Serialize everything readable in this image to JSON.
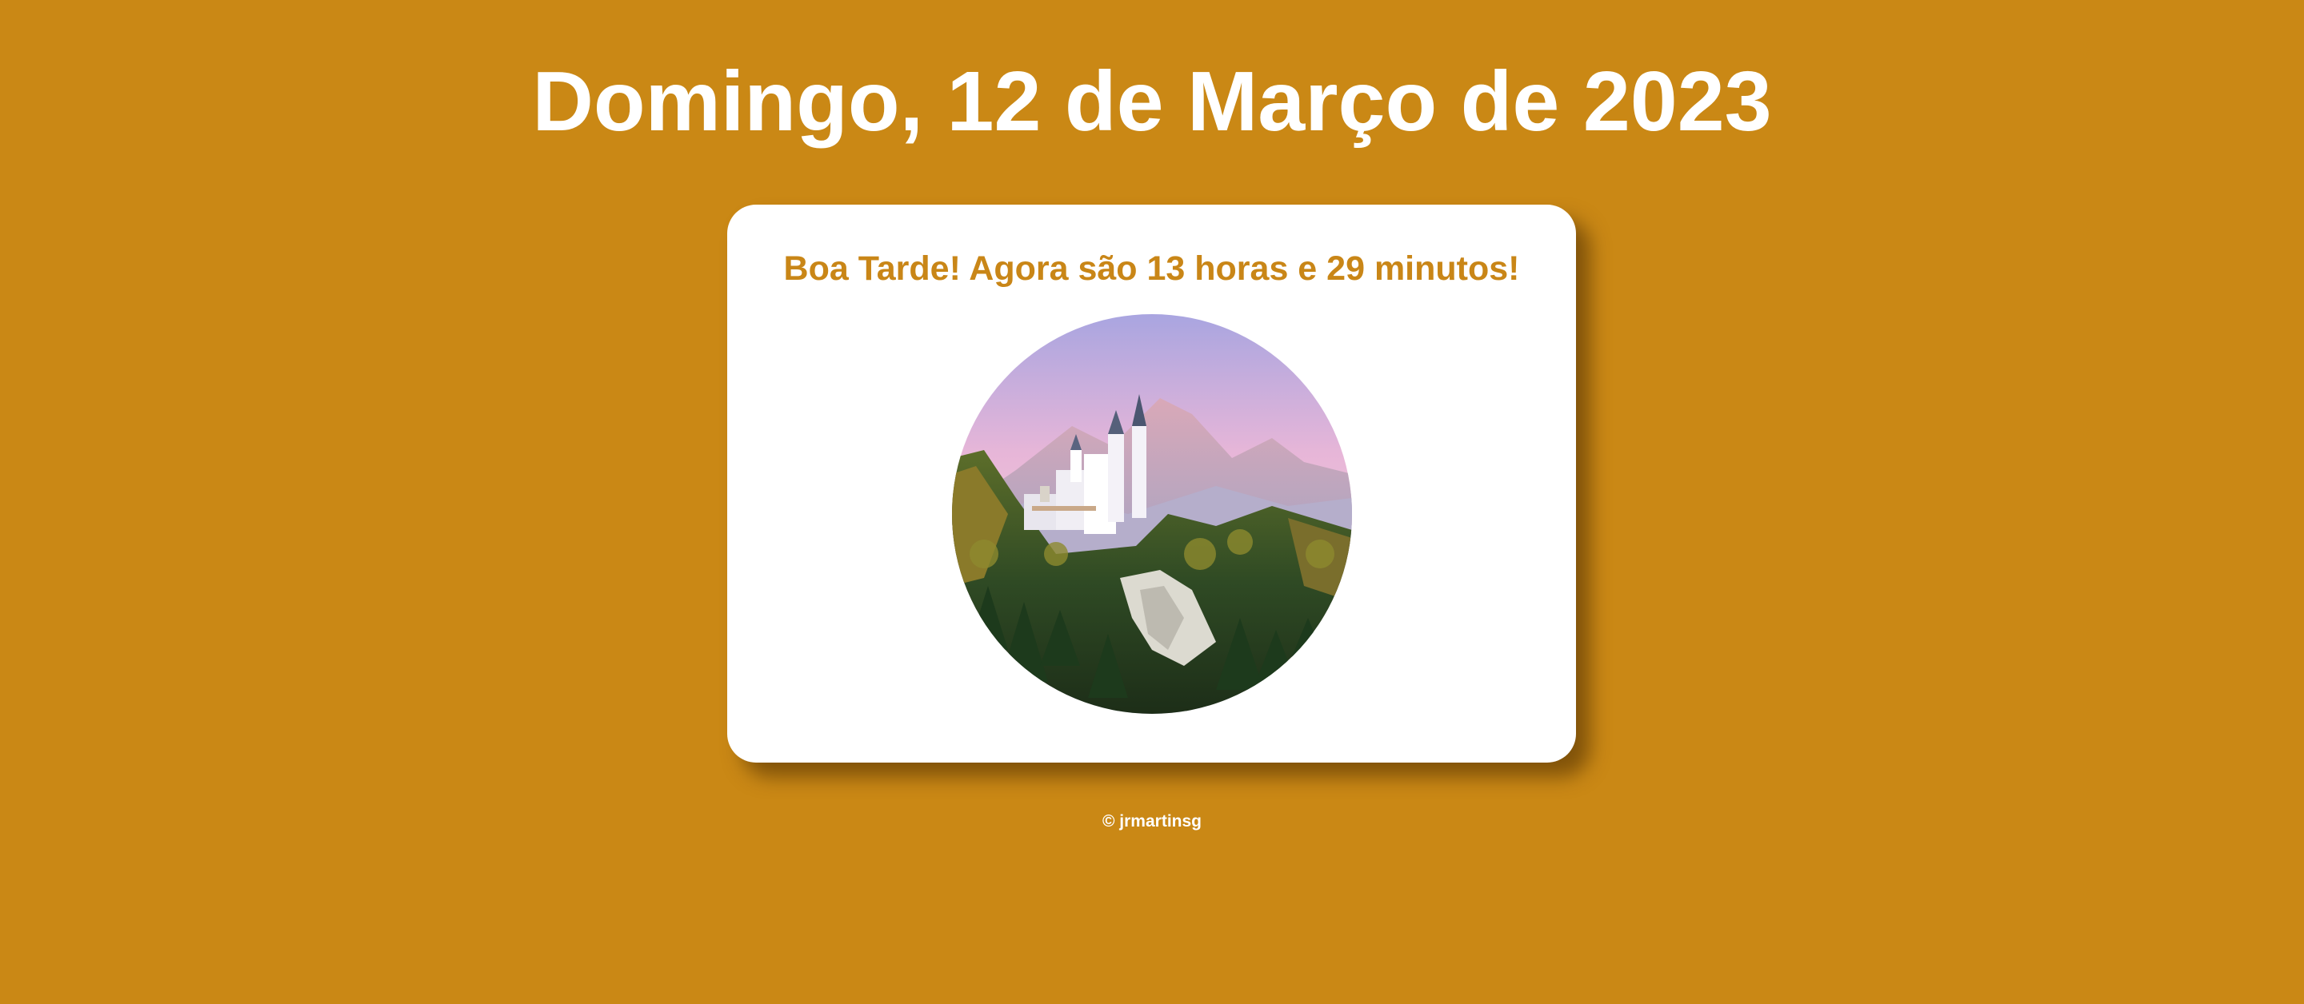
{
  "header": {
    "date_title": "Domingo, 12 de Março de 2023"
  },
  "card": {
    "greeting": "Boa Tarde! Agora são 13 horas e 29 minutos!",
    "image": "neuschwanstein-castle-photo"
  },
  "footer": {
    "credit": "© jrmartinsg"
  },
  "colors": {
    "background": "#ca8815",
    "greeting_text": "#c98617",
    "card": "#ffffff"
  }
}
